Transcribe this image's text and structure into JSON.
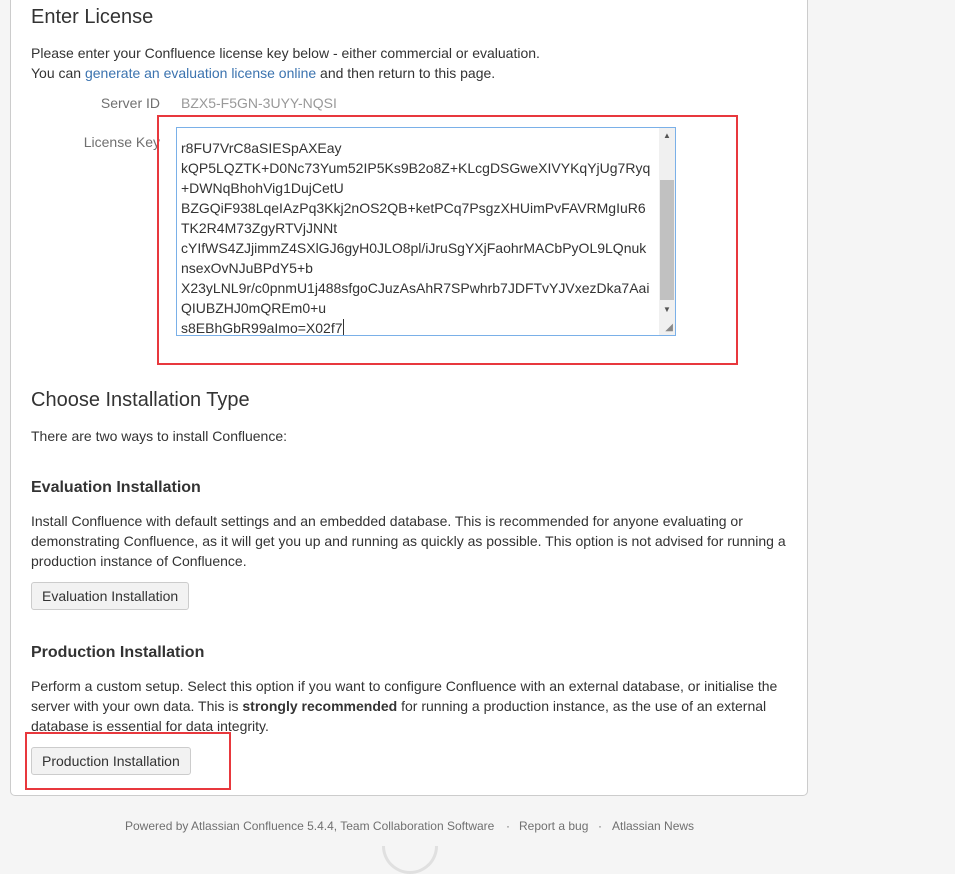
{
  "enter_license": {
    "title": "Enter License",
    "intro_line1": "Please enter your Confluence license key below - either commercial or evaluation.",
    "intro_line2_before": "You can ",
    "intro_link": "generate an evaluation license online",
    "intro_line2_after": " and then return to this page.",
    "server_id_label": "Server ID",
    "server_id_value": "BZX5-F5GN-3UYY-NQSI",
    "license_key_label": "License Key",
    "license_lines": [
      "",
      "r8FU7VrC8aSIESpAXEay",
      "kQP5LQZTK+D0Nc73Yum52IP5Ks9B2o8Z+KLcgDSGweXIVYKqYjUg7Ryq",
      "+DWNqBhohVig1DujCetU",
      "BZGQiF938LqeIAzPq3Kkj2nOS2QB+ketPCq7PsgzXHUimPvFAVRMgIuR6",
      "TK2R4M73ZgyRTVjJNNt",
      "cYIfWS4ZJjimmZ4SXlGJ6gyH0JLO8pl/iJruSgYXjFaohrMACbPyOL9LQnuk",
      "nsexOvNJuBPdY5+b",
      "X23yLNL9r/c0pnmU1j488sfgoCJuzAsAhR7SPwhrb7JDFTvYJVxezDka7Aai",
      "QIUBZHJ0mQREm0+u",
      "s8EBhGbR99aImo=X02f7"
    ]
  },
  "installation": {
    "title": "Choose Installation Type",
    "intro": "There are two ways to install Confluence:",
    "evaluation": {
      "heading": "Evaluation Installation",
      "desc_line1": "Install Confluence with default settings and an embedded database. This is recommended for anyone evaluating or",
      "desc_line2": "demonstrating Confluence, as it will get you up and running as quickly as possible. This option is not advised for running a",
      "desc_line3": "production instance of Confluence.",
      "button": "Evaluation Installation"
    },
    "production": {
      "heading": "Production Installation",
      "desc_line1": "Perform a custom setup. Select this option if you want to configure Confluence with an external database, or initialise the",
      "desc_line2_before": "server with your own data. This is ",
      "desc_line2_strong": "strongly recommended",
      "desc_line2_after": " for running a production instance, as the use of an external",
      "desc_line3": "database is essential for data integrity.",
      "button": "Production Installation"
    }
  },
  "footer": {
    "powered": "Powered by Atlassian Confluence 5.4.4, Team Collaboration Software",
    "sep1": "·",
    "report_bug": "Report a bug",
    "sep2": "·",
    "news": "Atlassian News"
  },
  "colors": {
    "highlight": "#e8383d",
    "link": "#3b73af",
    "focus_border": "#7ab0e8"
  }
}
